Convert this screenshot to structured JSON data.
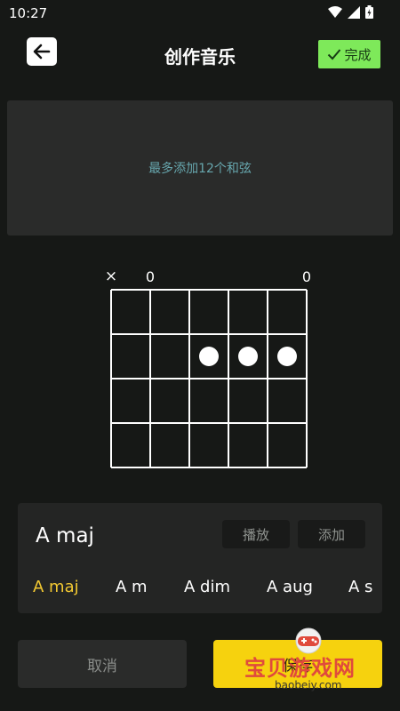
{
  "status": {
    "time": "10:27"
  },
  "header": {
    "title": "创作音乐",
    "done_label": "完成"
  },
  "slots": {
    "hint": "最多添加12个和弦"
  },
  "fretboard": {
    "string_marks": [
      "×",
      "0",
      "",
      "",
      "",
      "0"
    ],
    "finger_positions": [
      {
        "string": 3,
        "fret": 2
      },
      {
        "string": 4,
        "fret": 2
      },
      {
        "string": 5,
        "fret": 2
      }
    ]
  },
  "chord": {
    "name": "A maj",
    "play_label": "播放",
    "add_label": "添加",
    "types": [
      "A maj",
      "A m",
      "A dim",
      "A aug",
      "A s"
    ],
    "active_index": 0
  },
  "footer": {
    "cancel_label": "取消",
    "save_label": "保存"
  },
  "watermark": {
    "text": "宝贝游戏网",
    "url": "baobeiy.com"
  }
}
